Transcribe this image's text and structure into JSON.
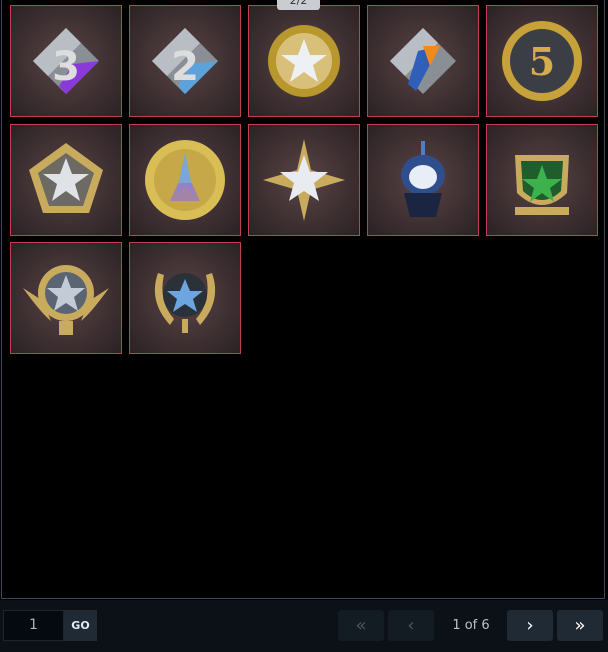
{
  "tooltip": "2/2",
  "items": [
    {
      "name": "season-3-coin-icon"
    },
    {
      "name": "season-2-coin-icon"
    },
    {
      "name": "gold-star-badge-icon"
    },
    {
      "name": "season-1-coin-icon"
    },
    {
      "name": "5-year-veteran-coin-icon"
    },
    {
      "name": "pentagon-star-medal-icon"
    },
    {
      "name": "gold-csgo-coin-icon"
    },
    {
      "name": "radiant-star-medal-icon"
    },
    {
      "name": "cupcake-pin-icon"
    },
    {
      "name": "green-star-shield-icon"
    },
    {
      "name": "winged-star-medal-icon"
    },
    {
      "name": "laurel-blue-star-medal-icon"
    }
  ],
  "pagination": {
    "page_value": "1",
    "go_label": "GO",
    "status": "1 of 6",
    "first_glyph": "«",
    "prev_glyph": "‹",
    "next_glyph": "›",
    "last_glyph": "»"
  }
}
